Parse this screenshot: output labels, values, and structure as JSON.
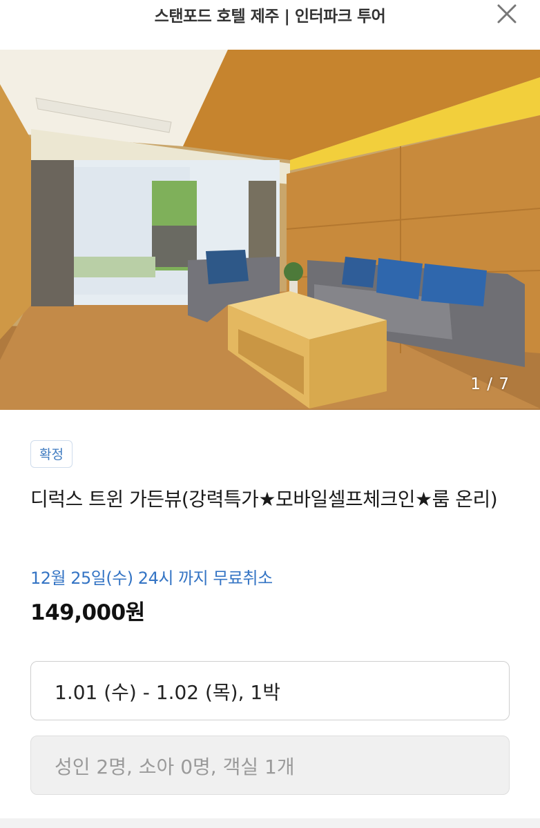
{
  "header": {
    "title": "스탠포드 호텔 제주 | 인터파크 투어",
    "close_icon": "close-icon"
  },
  "gallery": {
    "counter": "1 / 7"
  },
  "room": {
    "status_badge": "확정",
    "name": "디럭스 트윈 가든뷰(강력특가★모바일셀프체크인★룸 온리)",
    "cancel_info": "12월 25일(수) 24시 까지 무료취소",
    "price": "149,000원"
  },
  "booking": {
    "dates": "1.01 (수) - 1.02 (목), 1박",
    "guests": "성인 2명, 소아 0명, 객실 1개"
  },
  "colors": {
    "accent_blue": "#3474c4",
    "badge_border": "#cfdcec",
    "wood": "#c98b3a"
  }
}
